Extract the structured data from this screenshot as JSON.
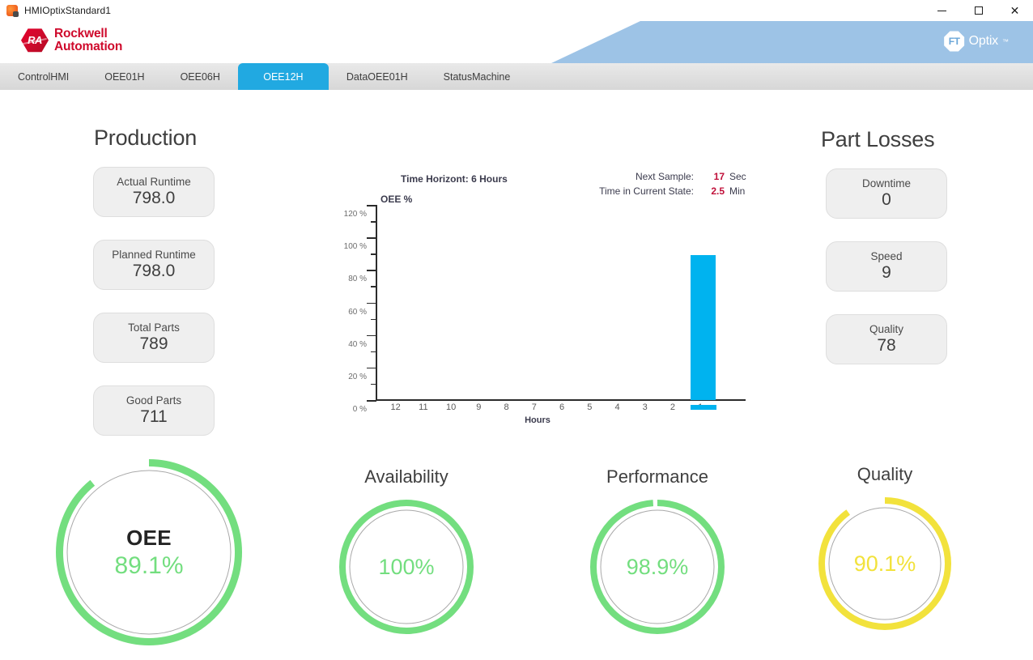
{
  "window": {
    "title": "HMIOptixStandard1",
    "app_icon": "optix-app-icon",
    "minimize_label": "—",
    "maximize_label": "□",
    "close_label": "✕"
  },
  "header": {
    "brand_line1": "Rockwell",
    "brand_line2": "Automation",
    "brand_badge": "RA",
    "product_mark": "FT",
    "product_name": "Optix",
    "product_tm": "™"
  },
  "tabs": [
    {
      "label": "ControlHMI",
      "active": false
    },
    {
      "label": "OEE01H",
      "active": false
    },
    {
      "label": "OEE06H",
      "active": false
    },
    {
      "label": "OEE12H",
      "active": true
    },
    {
      "label": "DataOEE01H",
      "active": false
    },
    {
      "label": "StatusMachine",
      "active": false
    }
  ],
  "production": {
    "title": "Production",
    "cards": [
      {
        "label": "Actual Runtime",
        "value": "798.0"
      },
      {
        "label": "Planned Runtime",
        "value": "798.0"
      },
      {
        "label": "Total Parts",
        "value": "789"
      },
      {
        "label": "Good Parts",
        "value": "711"
      }
    ]
  },
  "part_losses": {
    "title": "Part Losses",
    "cards": [
      {
        "label": "Downtime",
        "value": "0"
      },
      {
        "label": "Speed",
        "value": "9"
      },
      {
        "label": "Quality",
        "value": "78"
      }
    ]
  },
  "chart_header": {
    "time_horizon": "Time Horizont: 6 Hours",
    "series_label": "OEE %",
    "next_sample_label": "Next Sample:",
    "next_sample_value": "17",
    "next_sample_unit": "Sec",
    "current_state_label": "Time in Current State:",
    "current_state_value": "2.5",
    "current_state_unit": "Min"
  },
  "chart_data": {
    "type": "bar",
    "title": "Time Horizont: 6 Hours",
    "series_name": "OEE %",
    "xlabel": "Hours",
    "ylabel": "OEE %",
    "categories": [
      "12",
      "11",
      "10",
      "9",
      "8",
      "7",
      "6",
      "5",
      "4",
      "3",
      "2",
      "1"
    ],
    "values": [
      null,
      null,
      null,
      null,
      null,
      null,
      null,
      null,
      null,
      null,
      null,
      null
    ],
    "current_bar": {
      "label": "0",
      "value": 89.1
    },
    "ylim": [
      0,
      120
    ],
    "ytick_labels": [
      "0 %",
      "20 %",
      "40 %",
      "60 %",
      "80 %",
      "100 %",
      "120 %"
    ],
    "ytick_values": [
      0,
      20,
      40,
      60,
      80,
      100,
      120
    ],
    "yminor_step": 10,
    "grid": false,
    "legend": {
      "position": "below-bar",
      "entries": [
        "OEE %"
      ]
    },
    "bar_color": "#00b3ef"
  },
  "gauges": [
    {
      "name": "OEE",
      "title": "",
      "value_text": "89.1%",
      "percent": 89.1,
      "color": "#73DE7F",
      "track": "#9a9a9a",
      "show_inner_name": true
    },
    {
      "name": "Availability",
      "title": "Availability",
      "value_text": "100%",
      "percent": 100,
      "color": "#73DE7F",
      "track": "#9a9a9a",
      "show_inner_name": false
    },
    {
      "name": "Performance",
      "title": "Performance",
      "value_text": "98.9%",
      "percent": 98.9,
      "color": "#73DE7F",
      "track": "#9a9a9a",
      "show_inner_name": false
    },
    {
      "name": "Quality",
      "title": "Quality",
      "value_text": "90.1%",
      "percent": 90.1,
      "color": "#F2E23C",
      "track": "#9a9a9a",
      "show_inner_name": false
    }
  ],
  "colors": {
    "accent_blue": "#21a9e1",
    "bar_blue": "#00b3ef",
    "banner_blue": "#9dc3e6",
    "brand_red": "#cf0a2c",
    "gauge_green": "#73DE7F",
    "gauge_yellow": "#F2E23C",
    "alert_red": "#c0103a"
  }
}
